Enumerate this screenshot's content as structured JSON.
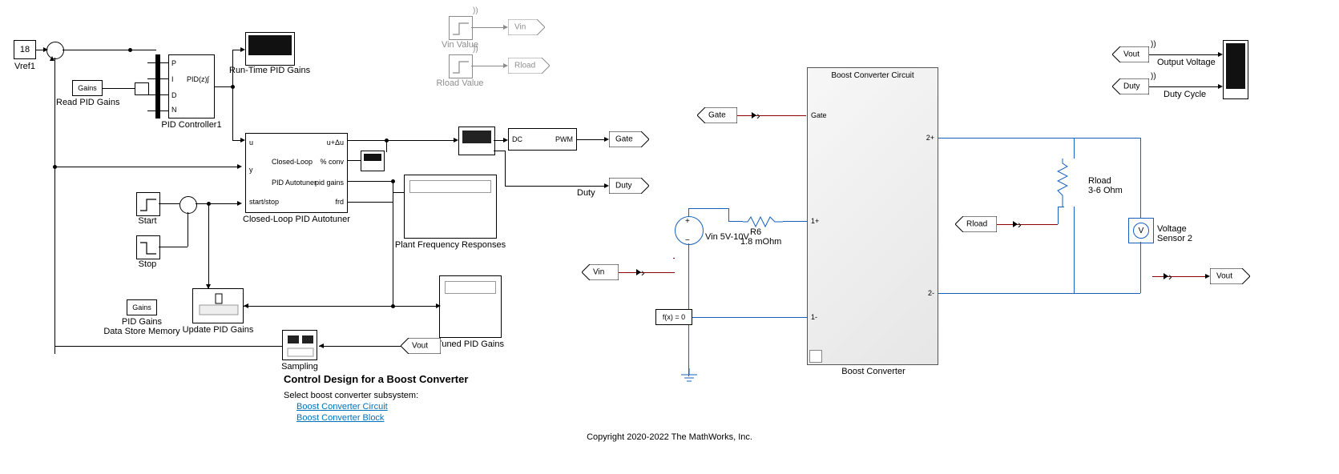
{
  "vref": {
    "value": "18",
    "label": "Vref1"
  },
  "readGains": {
    "text": "Gains",
    "label": "Read PID Gains"
  },
  "pid": {
    "port_p": "P",
    "port_i": "I",
    "port_d": "D",
    "port_n": "N",
    "expr": "PID(z)∫",
    "label": "PID Controller1"
  },
  "rtgains": {
    "label": "Run-Time PID Gains"
  },
  "autotuner": {
    "u": "u",
    "y": "y",
    "ss": "start/stop",
    "out1": "u+Δu",
    "out2": "% conv",
    "mid": "Closed-Loop",
    "mid2": "PID Autotuner",
    "out3": "pid gains",
    "out4": "frd",
    "label": "Closed-Loop PID Autotuner"
  },
  "start": {
    "label": "Start"
  },
  "stop": {
    "label": "Stop"
  },
  "dsm": {
    "text": "Gains",
    "label1": "PID Gains",
    "label2": "Data Store Memory"
  },
  "update": {
    "label": "Update PID Gains"
  },
  "sampling": {
    "label": "Sampling"
  },
  "plantresp": {
    "label": "Plant Frequency Responses"
  },
  "tunedgains": {
    "label": "Tuned PID Gains"
  },
  "convScope": {
    "label": ""
  },
  "pwm": {
    "in": "DC",
    "out": "PWM"
  },
  "tags": {
    "gate": "Gate",
    "duty": "Duty",
    "vout": "Vout",
    "vin": "Vin",
    "rload": "Rload",
    "dc": "DC"
  },
  "vinval": {
    "label": "Vin Value"
  },
  "rloadval": {
    "label": "Rload Value"
  },
  "circuit": {
    "title": "Boost Converter Circuit",
    "label": "Boost Converter",
    "p_gate": "Gate",
    "p_1p": "1+",
    "p_1m": "1-",
    "p_2p": "2+",
    "p_2m": "2-"
  },
  "vsrc": {
    "label": "Vin 5V-10V"
  },
  "r6": {
    "name": "R6",
    "val": "1.8 mOhm"
  },
  "rload": {
    "name": "Rload",
    "val": "3-6 Ohm"
  },
  "solver": {
    "text": "f(x) = 0"
  },
  "vsense": {
    "label": "Voltage\nSensor 2",
    "glyph": "V"
  },
  "outScopes": {
    "vout": "Vout",
    "vout_lbl": "Output Voltage",
    "duty": "Duty",
    "duty_lbl": "Duty Cycle"
  },
  "title": {
    "main": "Control Design for a Boost Converter",
    "sub": "Select boost converter subsystem:",
    "l1": "Boost Converter Circuit",
    "l2": "Boost Converter Block"
  },
  "copyright": "Copyright 2020-2022 The MathWorks, Inc."
}
